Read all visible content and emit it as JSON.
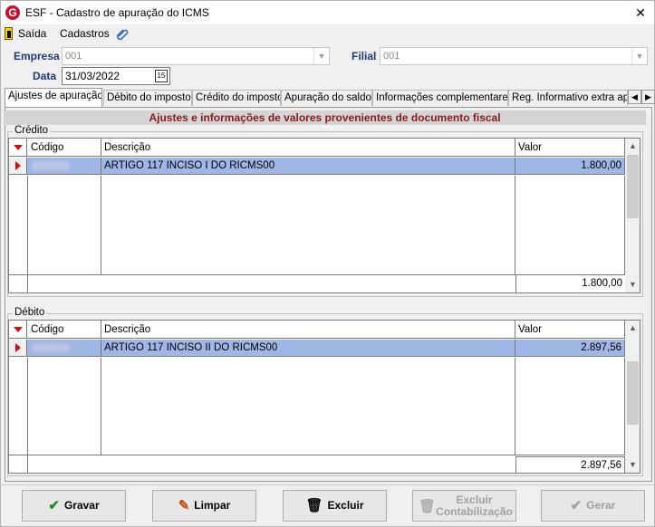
{
  "window": {
    "title": "ESF - Cadastro de apuração do ICMS",
    "logo_letter": "G",
    "close": "✕"
  },
  "menu": {
    "exit": "Saída",
    "register": "Cadastros"
  },
  "form": {
    "empresa_label": "Empresa",
    "empresa_value": "001",
    "filial_label": "Filial",
    "filial_value": "001",
    "data_label": "Data",
    "data_value": "31/03/2022",
    "date_button": "15"
  },
  "tabs": [
    {
      "label": "Ajustes de apuração",
      "active": true
    },
    {
      "label": "Débito do imposto"
    },
    {
      "label": "Crédito do imposto"
    },
    {
      "label": "Apuração do saldo"
    },
    {
      "label": "Informações complementares"
    },
    {
      "label": "Reg. Informativo extra apuração"
    }
  ],
  "panel": {
    "header": "Ajustes e informações de valores provenientes de documento fiscal"
  },
  "credito": {
    "title": "Crédito",
    "columns": [
      "Código",
      "Descrição",
      "Valor"
    ],
    "rows": [
      {
        "codigo": "",
        "descricao": "ARTIGO 117 INCISO I DO RICMS00",
        "valor": "1.800,00"
      }
    ],
    "total": "1.800,00"
  },
  "debito": {
    "title": "Débito",
    "columns": [
      "Código",
      "Descrição",
      "Valor"
    ],
    "rows": [
      {
        "codigo": "",
        "descricao": "ARTIGO 117 INCISO II DO RICMS00",
        "valor": "2.897,56"
      }
    ],
    "total": "2.897,56"
  },
  "buttons": {
    "gravar": "Gravar",
    "limpar": "Limpar",
    "excluir": "Excluir",
    "excluir_contab_1": "Excluir",
    "excluir_contab_2": "Contabilização",
    "gerar": "Gerar"
  },
  "colors": {
    "label_blue": "#1f3a78",
    "header_red": "#8b1a1a",
    "row_selected": "#9fb6e6",
    "indicator_red": "#d01010"
  }
}
